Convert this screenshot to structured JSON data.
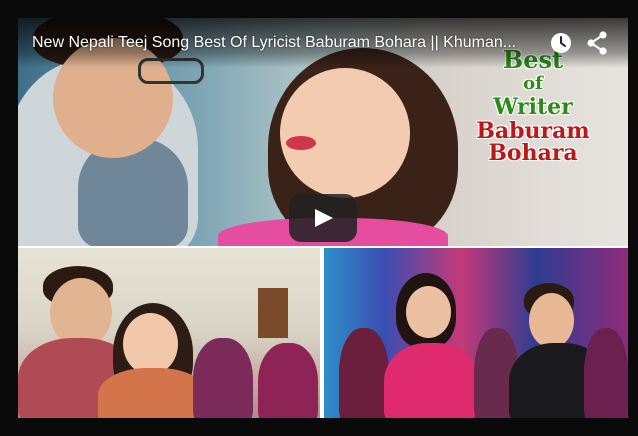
{
  "video": {
    "title": "New Nepali Teej Song Best Of Lyricist Baburam Bohara || Khuman...",
    "overlay_lines": [
      "Best",
      "of",
      "Writer",
      "Baburam Bohara"
    ],
    "icons": {
      "watch_later": "clock-icon",
      "share": "share-icon",
      "play": "play-icon"
    },
    "colors": {
      "overlay_green": "#2c8a18",
      "overlay_red": "#b81a1a",
      "play_button_bg": "#212121"
    }
  }
}
